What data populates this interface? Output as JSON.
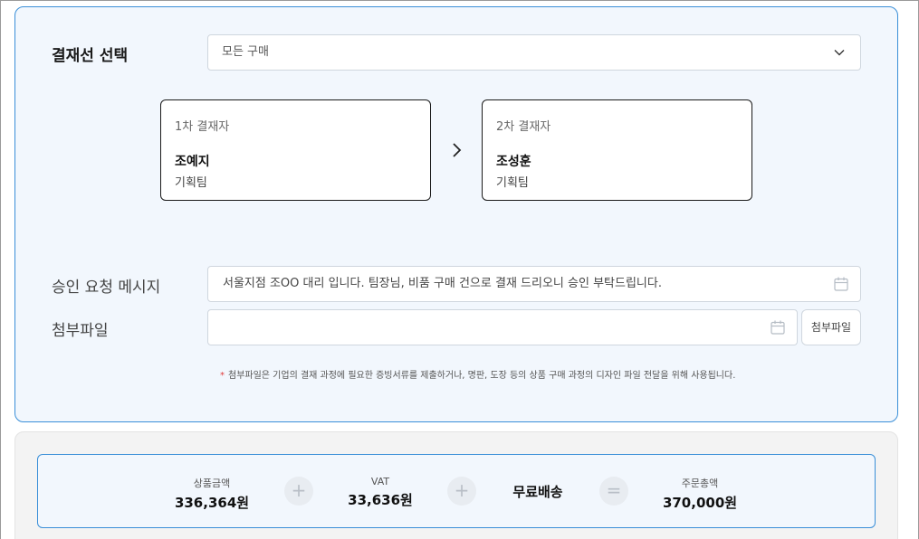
{
  "approval": {
    "line_label": "결재선 선택",
    "line_selected": "모든 구매",
    "approvers": [
      {
        "role": "1차 결재자",
        "name": "조예지",
        "team": "기획팀"
      },
      {
        "role": "2차 결재자",
        "name": "조성훈",
        "team": "기획팀"
      }
    ],
    "message_label": "승인 요청 메시지",
    "message_value": "서울지점 조OO 대리 입니다. 팀장님, 비품 구매 건으로 결재 드리오니 승인 부탁드립니다.",
    "attach_label": "첨부파일",
    "attach_value": "",
    "attach_button": "첨부파일",
    "note_star": "*",
    "note_text": "첨부파일은 기업의 결재 과정에 필요한 증빙서류를 제출하거나, 명판, 도장 등의 상품 구매 과정의 디자인 파일 전달을 위해 사용됩니다."
  },
  "summary": {
    "product_label": "상품금액",
    "product_value": "336,364원",
    "plus1": "+",
    "vat_label": "VAT",
    "vat_value": "33,636원",
    "plus2": "+",
    "shipping": "무료배송",
    "equals": "=",
    "total_label": "주문총액",
    "total_value": "370,000원"
  },
  "icons": {
    "dropdown": "chevron-down-icon",
    "step_arrow": "chevron-right-icon",
    "field_icon": "calendar-icon"
  },
  "colors": {
    "accent": "#3a8fd8",
    "panel_bg": "#f2f7fd",
    "required_star": "#e03b3b"
  }
}
